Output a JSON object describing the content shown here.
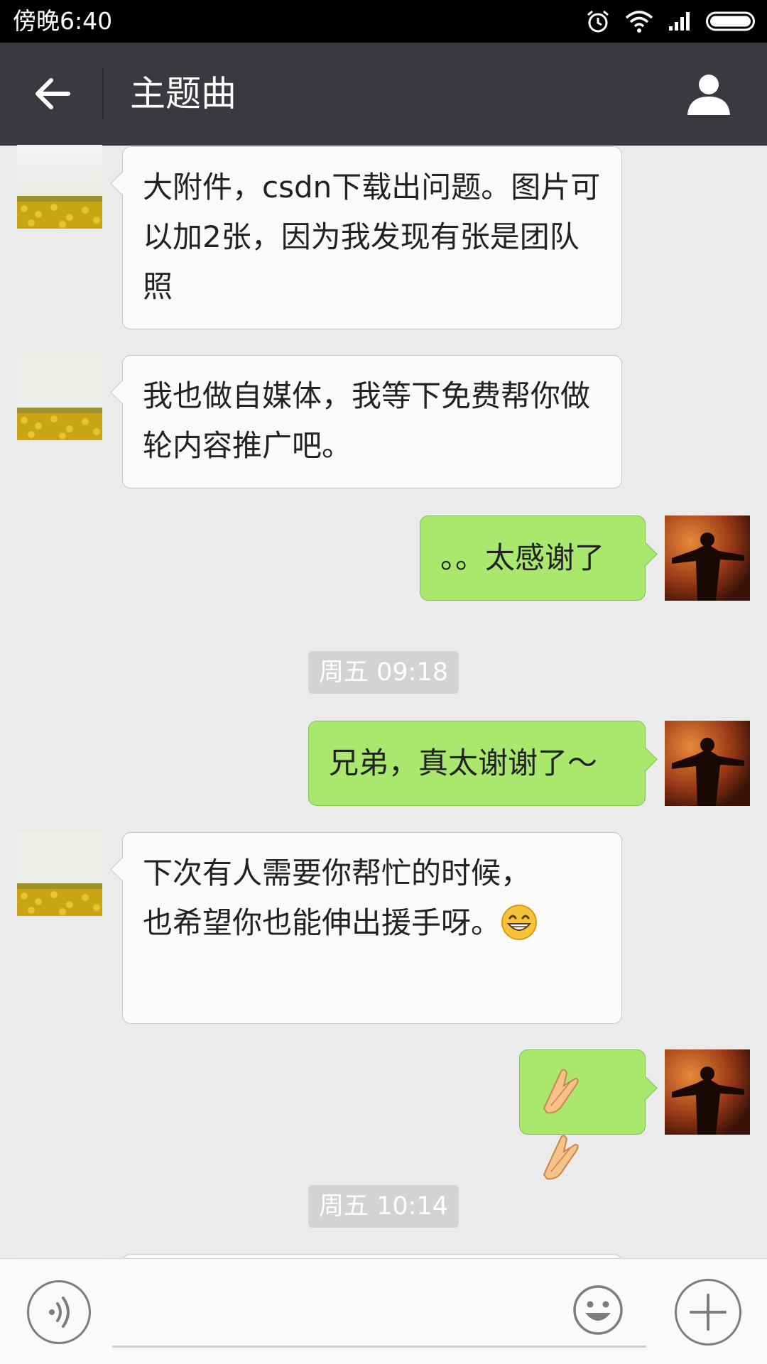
{
  "status_bar": {
    "time": "傍晚6:40"
  },
  "header": {
    "title": "主题曲"
  },
  "messages": [
    {
      "text": "大附件，csdn下载出问题。图片可以加2张，因为我发现有张是团队照"
    },
    {
      "text": "我也做自媒体，我等下免费帮你做轮内容推广吧。"
    },
    {
      "text": "。。太感谢了"
    },
    {
      "text": "兄弟，真太谢谢了～"
    },
    {
      "text": "下次有人需要你帮忙的时候，也希望你也能伸出援手呀。"
    },
    {
      "text": ""
    }
  ],
  "timestamps": [
    "周五 09:18",
    "周五 10:14"
  ],
  "input": {
    "value": ""
  },
  "colors": {
    "nav_bg": "#393a3f",
    "chat_bg": "#ebebeb",
    "bubble_self": "#a9e86c",
    "bubble_other": "#fafafa"
  },
  "icons": [
    "back-arrow-icon",
    "profile-icon",
    "voice-icon",
    "emoji-icon",
    "plus-icon",
    "grin-emoji-icon",
    "clap-emoji-icon",
    "alarm-icon",
    "wifi-icon",
    "signal-icon",
    "battery-icon"
  ]
}
